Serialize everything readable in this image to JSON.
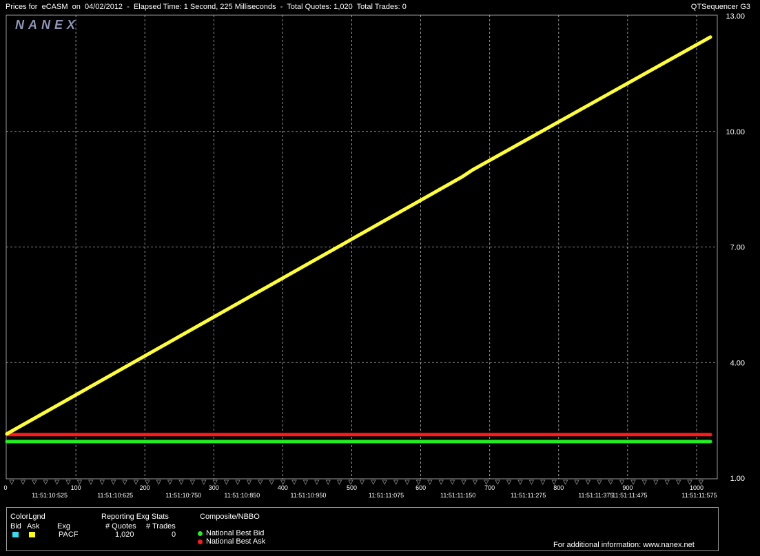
{
  "header": {
    "prefix": "Prices for",
    "symbol": "eCASM",
    "on_label": "on",
    "date": "04/02/2012",
    "elapsed": "Elapsed Time: 1 Second, 225 Milliseconds",
    "total_quotes": "Total Quotes: 1,020",
    "total_trades": "Total Trades: 0",
    "app_name": "QTSequencer G3"
  },
  "watermark": "NANEX",
  "colors": {
    "background": "#000000",
    "grid": "#bbbbbb",
    "ask": "#ffff33",
    "bid": "#22ee22",
    "nbbo_ask": "#ff1a1a",
    "legend_bid_swatch": "#33ddee",
    "legend_ask_swatch": "#ffff00"
  },
  "chart_data": {
    "type": "line",
    "title": "",
    "xlabel": "",
    "ylabel": "",
    "xlim": [
      0,
      1020
    ],
    "ylim": [
      1.0,
      13.0
    ],
    "grid": true,
    "y_axis_position": "right",
    "y_ticks": [
      "13.00",
      "10.00",
      "7.00",
      "4.00",
      "1.00"
    ],
    "y_tick_values": [
      13.0,
      10.0,
      7.0,
      4.0,
      1.0
    ],
    "x_ticks": [
      "0",
      "100",
      "200",
      "300",
      "400",
      "500",
      "600",
      "700",
      "800",
      "900",
      "1000"
    ],
    "x_tick_values": [
      0,
      100,
      200,
      300,
      400,
      500,
      600,
      700,
      800,
      900,
      1000
    ],
    "time_labels": [
      {
        "x": 62,
        "label": "11:51:10:525"
      },
      {
        "x": 157,
        "label": "11:51:10:625"
      },
      {
        "x": 256,
        "label": "11:51:10:750"
      },
      {
        "x": 341,
        "label": "11:51:10:850"
      },
      {
        "x": 437,
        "label": "11:51:10:950"
      },
      {
        "x": 550,
        "label": "11:51:11:075"
      },
      {
        "x": 654,
        "label": "11:51:11:150"
      },
      {
        "x": 756,
        "label": "11:51:11:275"
      },
      {
        "x": 854,
        "label": "11:51:11:375"
      },
      {
        "x": 903,
        "label": "11:51:11:475"
      },
      {
        "x": 1004,
        "label": "11:51:11:575"
      }
    ],
    "series": [
      {
        "name": "",
        "color": "#ffff33",
        "x": [
          0,
          660,
          675,
          1020
        ],
        "y": [
          2.15,
          8.82,
          9.0,
          12.45
        ]
      },
      {
        "name": "National Best Ask",
        "color": "#ff1a1a",
        "x": [
          0,
          1020
        ],
        "y": [
          2.13,
          2.13
        ]
      },
      {
        "name": "National Best Bid",
        "color": "#22ee22",
        "x": [
          0,
          1020
        ],
        "y": [
          1.95,
          1.95
        ]
      }
    ]
  },
  "legend": {
    "color_lgnd": "ColorLgnd",
    "bid": "Bid",
    "ask": "Ask",
    "exg": "Exg",
    "exchange": "PACF",
    "reporting_title": "Reporting Exg Stats",
    "quotes_header": "# Quotes",
    "trades_header": "# Trades",
    "quotes_value": "1,020",
    "trades_value": "0",
    "composite_title": "Composite/NBBO",
    "nbb_label": "National Best Bid",
    "nba_label": "National Best Ask",
    "footer": "For additional information: www.nanex.net"
  }
}
